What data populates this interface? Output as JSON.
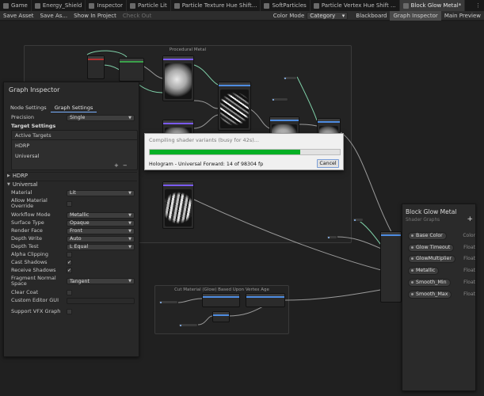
{
  "tabs": [
    {
      "label": "Game",
      "icon": "game-icon"
    },
    {
      "label": "Energy_Shield",
      "icon": "shader-icon"
    },
    {
      "label": "Inspector",
      "icon": "info-icon"
    },
    {
      "label": "Particle Lit",
      "icon": "shader-icon"
    },
    {
      "label": "Particle Texture Hue Shift...",
      "icon": "shader-icon"
    },
    {
      "label": "SoftParticles",
      "icon": "shader-icon"
    },
    {
      "label": "Particle Vertex Hue Shift ...",
      "icon": "shader-icon"
    },
    {
      "label": "Block Glow Metal*",
      "icon": "shader-icon",
      "active": true
    }
  ],
  "toolbar": {
    "save_asset": "Save Asset",
    "save_as": "Save As...",
    "show_in_project": "Show In Project",
    "check_out": "Check Out",
    "color_mode_label": "Color Mode",
    "color_mode_value": "Category",
    "blackboard": "Blackboard",
    "graph_inspector": "Graph Inspector",
    "main_preview": "Main Preview"
  },
  "graph": {
    "group_procedural": "Procedural Metal",
    "group_cut": "Cut Material (Glow) Based Upon Vertex Age"
  },
  "inspector": {
    "title": "Graph Inspector",
    "tab_node": "Node Settings",
    "tab_graph": "Graph Settings",
    "precision_label": "Precision",
    "precision_value": "Single",
    "target_settings": "Target Settings",
    "active_targets": "Active Targets",
    "targets": [
      "HDRP",
      "Universal"
    ],
    "plus": "+",
    "minus": "−",
    "section_hdrp": "HDRP",
    "section_universal": "Universal",
    "rows": {
      "material": {
        "label": "Material",
        "value": "Lit"
      },
      "allow_override": {
        "label": "Allow Material Override"
      },
      "workflow": {
        "label": "Workflow Mode",
        "value": "Metallic"
      },
      "surface": {
        "label": "Surface Type",
        "value": "Opaque"
      },
      "render_face": {
        "label": "Render Face",
        "value": "Front"
      },
      "depth_write": {
        "label": "Depth Write",
        "value": "Auto"
      },
      "depth_test": {
        "label": "Depth Test",
        "value": "L Equal"
      },
      "alpha_clipping": {
        "label": "Alpha Clipping"
      },
      "cast_shadows": {
        "label": "Cast Shadows",
        "checked": true
      },
      "receive_shadows": {
        "label": "Receive Shadows",
        "checked": true
      },
      "fragment_normal": {
        "label": "Fragment Normal Space",
        "value": "Tangent"
      },
      "clear_coat": {
        "label": "Clear Coat"
      },
      "custom_editor": {
        "label": "Custom Editor GUI"
      },
      "support_vfx": {
        "label": "Support VFX Graph"
      }
    },
    "check_mark": "✓"
  },
  "progress": {
    "title": "Compiling shader variants (busy for 42s)...",
    "fraction": 0.79,
    "message": "Hologram - Universal Forward: 14 of 98304 fp",
    "cancel": "Cancel"
  },
  "blackboard": {
    "title": "Block Glow Metal",
    "subtitle": "Shader Graphs",
    "add": "+",
    "properties": [
      {
        "name": "Base Color",
        "type": "Color"
      },
      {
        "name": "Glow Timeout",
        "type": "Float"
      },
      {
        "name": "GlowMultiplier",
        "type": "Float"
      },
      {
        "name": "Metallic",
        "type": "Float"
      },
      {
        "name": "Smooth_Min",
        "type": "Float"
      },
      {
        "name": "Smooth_Max",
        "type": "Float"
      }
    ]
  },
  "colors": {
    "accent_tab": "#7ab0ff",
    "progress_fill": "#06b025",
    "node_header": "#7a5af0"
  }
}
